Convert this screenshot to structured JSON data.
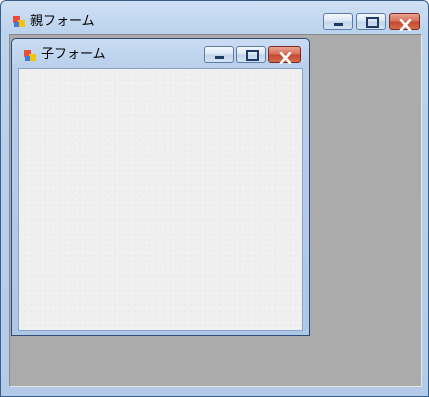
{
  "parent_window": {
    "title": "親フォーム",
    "icon": "windows-form-icon",
    "caption_buttons": [
      "minimize",
      "maximize",
      "close"
    ]
  },
  "child_window": {
    "title": "子フォーム",
    "icon": "windows-form-icon",
    "caption_buttons": [
      "minimize",
      "maximize",
      "close"
    ]
  },
  "colors": {
    "mdi_background": "#ababab",
    "client_area": "#f0f0f0",
    "frame": "#b3cbe8",
    "close_button": "#c44a31"
  }
}
